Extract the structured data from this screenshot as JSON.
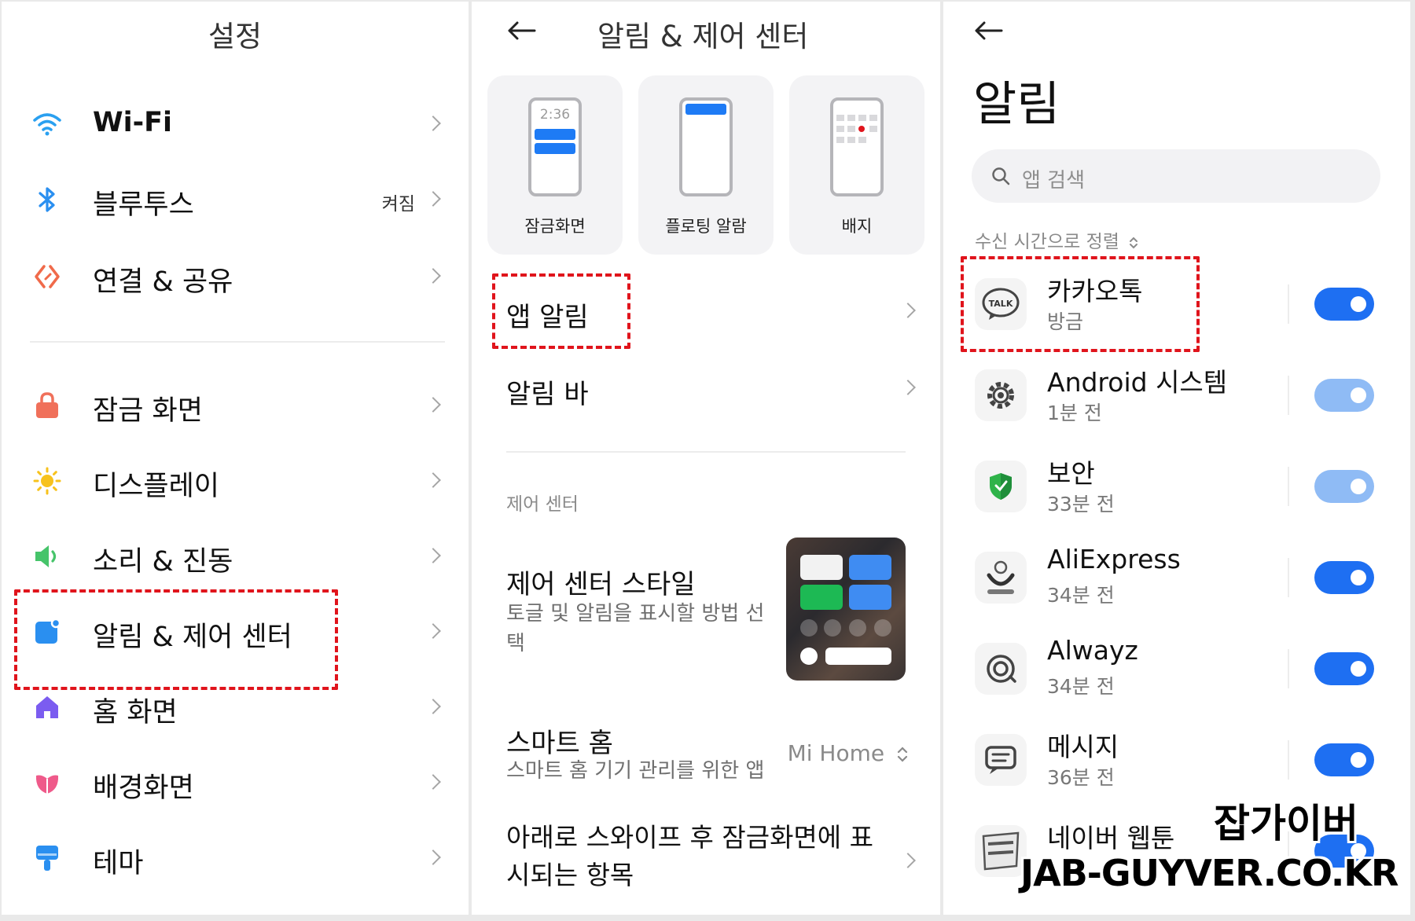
{
  "colors": {
    "accent": "#1e6ff2",
    "accent_dim": "#8fbbf5",
    "highlight": "#e0141c",
    "chevron": "#a6a6a6"
  },
  "settings": {
    "title": "설정",
    "items": [
      {
        "label": "Wi-Fi",
        "value": "",
        "icon": "wifi-icon"
      },
      {
        "label": "블루투스",
        "value": "켜짐",
        "icon": "bluetooth-icon"
      },
      {
        "label": "연결 & 공유",
        "value": "",
        "icon": "connection-share-icon"
      },
      {
        "label": "잠금 화면",
        "value": "",
        "icon": "lock-icon"
      },
      {
        "label": "디스플레이",
        "value": "",
        "icon": "sun-icon"
      },
      {
        "label": "소리 & 진동",
        "value": "",
        "icon": "speaker-icon"
      },
      {
        "label": "알림 & 제어 센터",
        "value": "",
        "icon": "notification-icon"
      },
      {
        "label": "홈 화면",
        "value": "",
        "icon": "home-icon"
      },
      {
        "label": "배경화면",
        "value": "",
        "icon": "flower-icon"
      },
      {
        "label": "테마",
        "value": "",
        "icon": "theme-brush-icon"
      }
    ]
  },
  "notif_center": {
    "title": "알림 & 제어 센터",
    "cards": [
      {
        "label": "잠금화면",
        "clock": "2:36"
      },
      {
        "label": "플로팅 알람"
      },
      {
        "label": "배지"
      }
    ],
    "app_notifications": "앱 알림",
    "notification_bar": "알림 바",
    "section_label": "제어 센터",
    "control_center_style": {
      "title": "제어 센터 스타일",
      "subtitle": "토글 및 알림을 표시할 방법 선택"
    },
    "smart_home": {
      "title": "스마트 홈",
      "subtitle": "스마트 홈 기기 관리를 위한 앱",
      "value": "Mi Home"
    },
    "swipe_items": "아래로 스와이프 후 잠금화면에 표시되는 항목"
  },
  "notifications": {
    "title": "알림",
    "search_placeholder": "앱 검색",
    "sort_label": "수신 시간으로 정렬",
    "apps": [
      {
        "name": "카카오톡",
        "time": "방금",
        "enabled": true,
        "dim": false,
        "icon": "kakaotalk-icon"
      },
      {
        "name": "Android 시스템",
        "time": "1분 전",
        "enabled": true,
        "dim": true,
        "icon": "android-system-gear-icon"
      },
      {
        "name": "보안",
        "time": "33분 전",
        "enabled": true,
        "dim": true,
        "icon": "security-shield-icon"
      },
      {
        "name": "AliExpress",
        "time": "34분 전",
        "enabled": true,
        "dim": false,
        "icon": "aliexpress-icon"
      },
      {
        "name": "Alwayz",
        "time": "34분 전",
        "enabled": true,
        "dim": false,
        "icon": "alwayz-icon"
      },
      {
        "name": "메시지",
        "time": "36분 전",
        "enabled": true,
        "dim": false,
        "icon": "message-icon"
      },
      {
        "name": "네이버 웹툰",
        "time": "",
        "enabled": true,
        "dim": false,
        "icon": "naver-webtoon-icon"
      }
    ]
  },
  "watermark": {
    "korean": "잡가이버",
    "url": "JAB-GUYVER.CO.KR"
  }
}
